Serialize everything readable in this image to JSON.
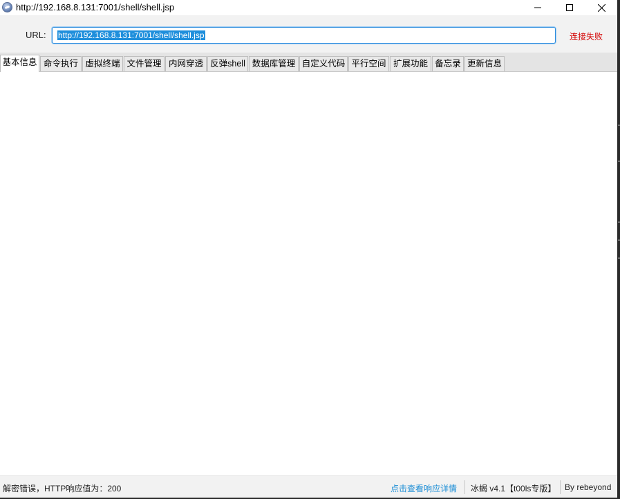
{
  "window": {
    "title": "http://192.168.8.131:7001/shell/shell.jsp"
  },
  "url_bar": {
    "label": "URL:",
    "value": "http://192.168.8.131:7001/shell/shell.jsp",
    "status": "连接失败",
    "status_color": "#d40000"
  },
  "tabs": [
    {
      "label": "基本信息",
      "active": true
    },
    {
      "label": "命令执行",
      "active": false
    },
    {
      "label": "虚拟终端",
      "active": false
    },
    {
      "label": "文件管理",
      "active": false
    },
    {
      "label": "内网穿透",
      "active": false
    },
    {
      "label": "反弹shell",
      "active": false
    },
    {
      "label": "数据库管理",
      "active": false
    },
    {
      "label": "自定义代码",
      "active": false
    },
    {
      "label": "平行空间",
      "active": false
    },
    {
      "label": "扩展功能",
      "active": false
    },
    {
      "label": "备忘录",
      "active": false
    },
    {
      "label": "更新信息",
      "active": false
    }
  ],
  "status_bar": {
    "message": "解密错误，HTTP响应值为：200",
    "details_link": "点击查看响应详情",
    "version": "冰蝎 v4.1【t00ls专版】",
    "author": "By rebeyond",
    "link_color": "#1e8fd6"
  },
  "icons": {
    "app": "app-icon",
    "minimize": "minimize-icon",
    "maximize": "maximize-icon",
    "close": "close-icon"
  }
}
